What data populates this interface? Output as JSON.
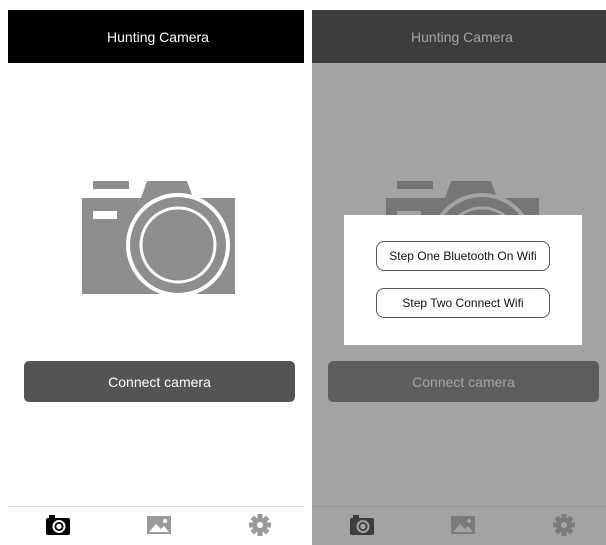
{
  "app": {
    "title": "Hunting Camera"
  },
  "main": {
    "connect_label": "Connect camera"
  },
  "dialog": {
    "step_one_label": "Step One Bluetooth On Wifi",
    "step_two_label": "Step Two Connect Wifi"
  },
  "tabs": [
    {
      "icon": "camera-icon",
      "selected": true
    },
    {
      "icon": "gallery-icon",
      "selected": false
    },
    {
      "icon": "gear-icon",
      "selected": false
    }
  ],
  "colors": {
    "navbar": "#000000",
    "button": "#545454",
    "illustration": "#8e8e8e",
    "overlay": "rgba(102,102,102,0.6)"
  }
}
